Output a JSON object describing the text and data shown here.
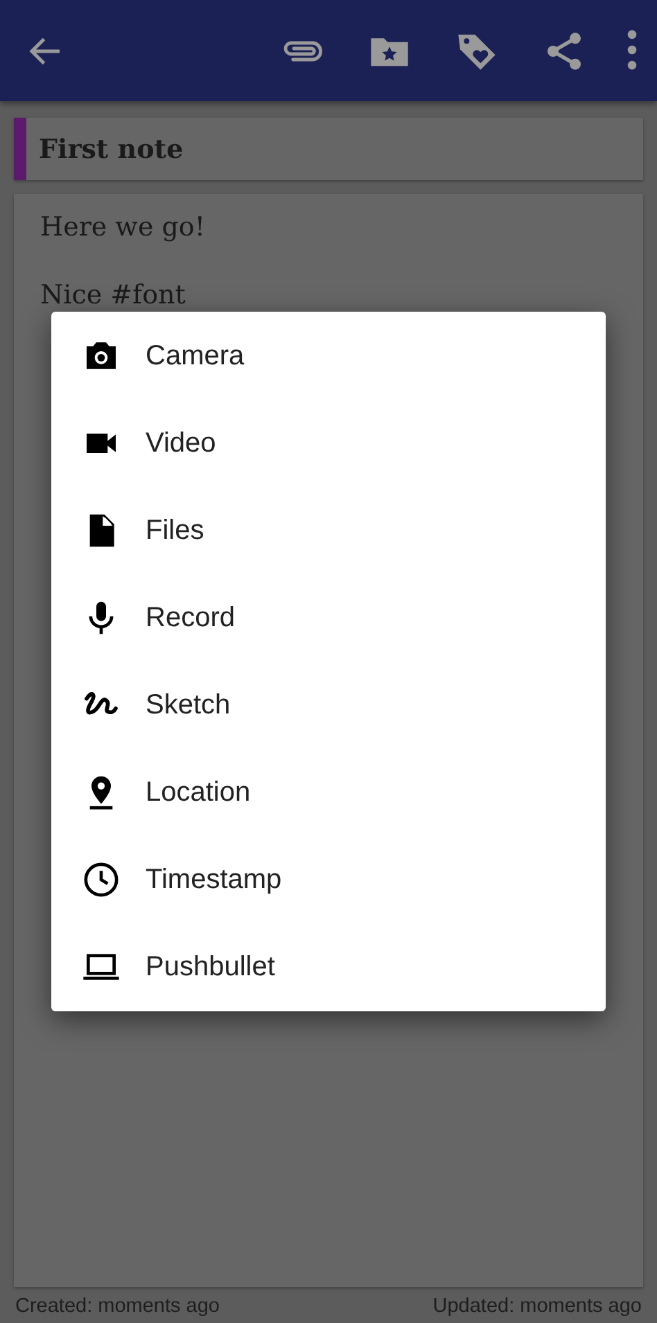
{
  "toolbar": {
    "actions": [
      {
        "kind": "attach"
      },
      {
        "kind": "category"
      },
      {
        "kind": "tag"
      },
      {
        "kind": "share"
      },
      {
        "kind": "more"
      }
    ]
  },
  "note": {
    "title": "First note",
    "color": "#5c1a6c",
    "body": [
      "Here we go!",
      "Nice #font"
    ]
  },
  "footer": {
    "created": "Created: moments ago",
    "updated": "Updated: moments ago"
  },
  "dialog": {
    "items": [
      {
        "kind": "camera",
        "label": "Camera"
      },
      {
        "kind": "video",
        "label": "Video"
      },
      {
        "kind": "files",
        "label": "Files"
      },
      {
        "kind": "record",
        "label": "Record"
      },
      {
        "kind": "sketch",
        "label": "Sketch"
      },
      {
        "kind": "location",
        "label": "Location"
      },
      {
        "kind": "timestamp",
        "label": "Timestamp"
      },
      {
        "kind": "pushbullet",
        "label": "Pushbullet"
      }
    ]
  }
}
